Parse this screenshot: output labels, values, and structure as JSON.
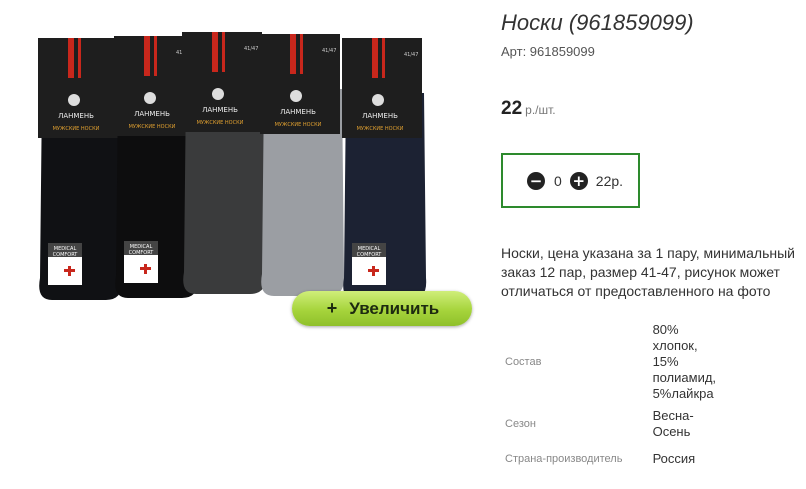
{
  "product": {
    "title": "Носки (961859099)",
    "article": "Арт: 961859099",
    "price_value": "22",
    "price_unit": "р./шт.",
    "description": "Носки, цена указана за 1 пару, минимальный заказ 12 пар, размер 41-47, рисунок может отличаться от предоставленного на фото"
  },
  "image": {
    "zoom_label": "Увеличить",
    "zoom_plus": "+",
    "brand_text": "ЛАНМЕНЬ",
    "package_subtitle": "МУЖСКИЕ НОСКИ",
    "size_label": "41/47",
    "badge_line1": "MEDICAL",
    "badge_line2": "COMFORT",
    "sock_colors": [
      "#101114",
      "#0d0d0e",
      "#3a3b3c",
      "#9b9ea3",
      "#1c2233"
    ]
  },
  "cart": {
    "minus": "−",
    "plus": "+",
    "quantity": "0",
    "total": "22р."
  },
  "properties": [
    {
      "name": "Состав",
      "value": "80% хлопок, 15% полиамид, 5%лайкра"
    },
    {
      "name": "Сезон",
      "value": "Весна-Осень"
    },
    {
      "name": "Страна-производитель",
      "value": "Россия"
    }
  ],
  "colors": {
    "cart_border": "#2d8a2d",
    "zoom_button": "#a6d43c",
    "package_red": "#c8271c"
  }
}
